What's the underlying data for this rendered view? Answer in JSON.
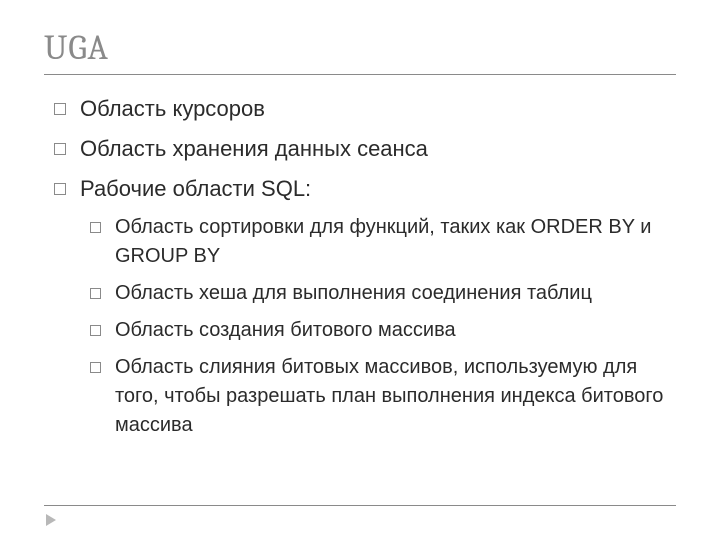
{
  "title": "UGA",
  "bullets": {
    "b0": "Область курсоров",
    "b1": "Область хранения данных сеанса",
    "b2": "Рабочие области SQL:"
  },
  "sub": {
    "s0": "Область сортировки для функций, таких как ORDER BY и GROUP BY",
    "s1": "Область хеша для выполнения соединения таблиц",
    "s2": "Область создания битового массива",
    "s3": "Область слияния битовых массивов, используемую для того, чтобы разрешать план выполнения индекса битового массива"
  }
}
